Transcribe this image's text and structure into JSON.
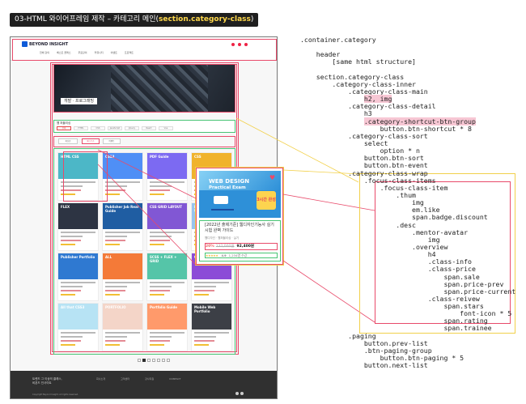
{
  "slide": {
    "title_main": "03-HTML 와이어프레임 제작 – 카테고리 메인(",
    "title_highlight": "section.category-class",
    "title_end": ")"
  },
  "mock": {
    "logo": "BEYOND INSIGHT",
    "nav": [
      "전체 강의",
      "베스트 클래스",
      "무료강의",
      "커뮤니티",
      "이벤트",
      "프로젝트"
    ],
    "hero_label": "개발 · 프로그래밍",
    "detail_title": "웹 퍼블리싱",
    "tabs": [
      "전체",
      "HTML",
      "CSS",
      "JavaScript",
      "jQuery",
      "React",
      "Vue"
    ],
    "sort_select": "최신순",
    "sort_buttons": [
      "베스트순",
      "이벤트"
    ],
    "cards": [
      {
        "label": "HTML\nCSS",
        "color": "#4cb7c7"
      },
      {
        "label": "CSS3",
        "color": "#4f8ff6"
      },
      {
        "label": "PDF Guide",
        "color": "#7c6af2"
      },
      {
        "label": "CSS",
        "color": "#f0b32c"
      },
      {
        "label": "FLEX",
        "color": "#2d3443"
      },
      {
        "label": "Publisher Job Real Guide",
        "color": "#1f5da2"
      },
      {
        "label": "CSS GRID LAYOUT",
        "color": "#8157d4"
      },
      {
        "label": "Responsive Website",
        "color": "#96c4ef"
      },
      {
        "label": "Publisher Portfolio",
        "color": "#2f79d1"
      },
      {
        "label": "ALL",
        "color": "#f47a38"
      },
      {
        "label": "SCSS + FLEX + GRID",
        "color": "#55c5a8"
      },
      {
        "label": "GIT",
        "color": "#8c4bd7"
      },
      {
        "label": "All that CSS3",
        "color": "#b7e3f4"
      },
      {
        "label": "PORTFOLIO",
        "color": "#f4d5c8"
      },
      {
        "label": "Portfolio Guide",
        "color": "#ff9a6b"
      },
      {
        "label": "Mobile Web Portfolio",
        "color": "#3c3f46"
      }
    ],
    "footer_line1": "트렌드 그 이상의 클래스,",
    "footer_line2": "비욘드 인사이트",
    "footer_cols": [
      "회사소개",
      "고객센터",
      "강사지원",
      "CONTACT"
    ],
    "copyright": "Copyright Beyond Insight. All rights reserved."
  },
  "zoom": {
    "thumb_title1": "WEB DESIGN",
    "thumb_title2": "Practical Exam",
    "thumb_badge": "3시간 완성",
    "lecture": "[2022년 출제기준] 웹디자인기능사 실기시험 완벽 가이드",
    "meta": "웹디자인 · 웹퍼블리싱 · 실기",
    "sale": "20%",
    "prev_price": "132,000원",
    "current_price": "92,400원",
    "stars": "★★★★★",
    "rating": "4.9",
    "trainee": "1,234명 수강"
  },
  "code_lines": [
    ".container.category",
    "",
    "    header",
    "        [same html structure]",
    "",
    "    section.category-class",
    "        .category-class-inner",
    "            .category-class-main",
    "                h2, img",
    "            .category-class-detail",
    "                h3",
    "                .category-shortcut-btn-group",
    "                    button.btn-shortcut * 8",
    "            .category-class-sort",
    "                select",
    "                    option * n",
    "                button.btn-sort",
    "                button.btn-event",
    "            .category-class-wrap",
    "                .focus-class-items",
    "                    .focus-class-item",
    "                        .thum",
    "                            img",
    "                            em.like",
    "                            span.badge.discount",
    "                        .desc",
    "                            .mentor-avatar",
    "                                img",
    "                            .overview",
    "                                h4",
    "                                .class-info",
    "                                .class-price",
    "                                    span.sale",
    "                                    span.price-prev",
    "                                    span.price-current",
    "                                .class-reivew",
    "                                    span.stars",
    "                                        font-icon * 5",
    "                                    span.rating",
    "                                    span.trainee",
    "            .paging",
    "                button.prev-list",
    "                .btn-paging-group",
    "                    button.btn-paging * 5",
    "                button.next-list"
  ],
  "colors": {
    "red_outline": "#e84a6a",
    "green_outline": "#48c474",
    "yellow_outline": "#f2d04a",
    "slide_title_bg": "#1f1f1f"
  }
}
